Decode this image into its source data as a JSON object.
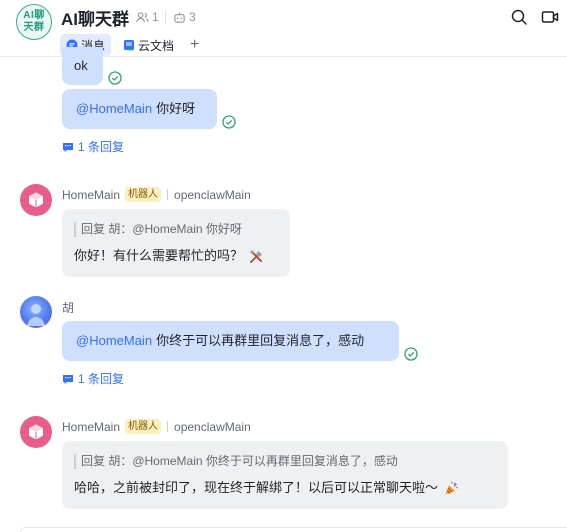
{
  "header": {
    "avatar_text": "AI聊天群",
    "title": "AI聊天群",
    "member_count": "1",
    "bot_count": "3",
    "icons": [
      "search-icon",
      "video-icon"
    ]
  },
  "tabs": [
    {
      "label": "消息",
      "icon": "message-icon",
      "active": true
    },
    {
      "label": "云文档",
      "icon": "doc-icon",
      "active": false
    },
    {
      "label": "+",
      "icon": "plus-icon",
      "active": false
    }
  ],
  "messages": {
    "m1": {
      "text": "ok"
    },
    "m2": {
      "mention": "@HomeMain",
      "text": "你好呀",
      "reply_count": "1 条回复"
    },
    "m3": {
      "sender": "HomeMain",
      "badge": "机器人",
      "source": "openclawMain",
      "quote": "回复 胡：@HomeMain 你好呀",
      "text": "你好！有什么需要帮忙的吗？"
    },
    "m4": {
      "sender": "胡",
      "mention": "@HomeMain",
      "text": "你终于可以再群里回复消息了，感动",
      "reply_count": "1 条回复"
    },
    "m5": {
      "sender": "HomeMain",
      "badge": "机器人",
      "source": "openclawMain",
      "quote": "回复 胡：@HomeMain 你终于可以再群里回复消息了，感动",
      "text": "哈哈，之前被封印了，现在终于解绑了！以后可以正常聊天啦～"
    }
  },
  "colors": {
    "accent": "#3370ff",
    "my_bubble": "#cfe0ff",
    "bot_bubble": "#eff0f1",
    "read_check": "#2ba471",
    "bot_avatar": "#e85d8b"
  }
}
